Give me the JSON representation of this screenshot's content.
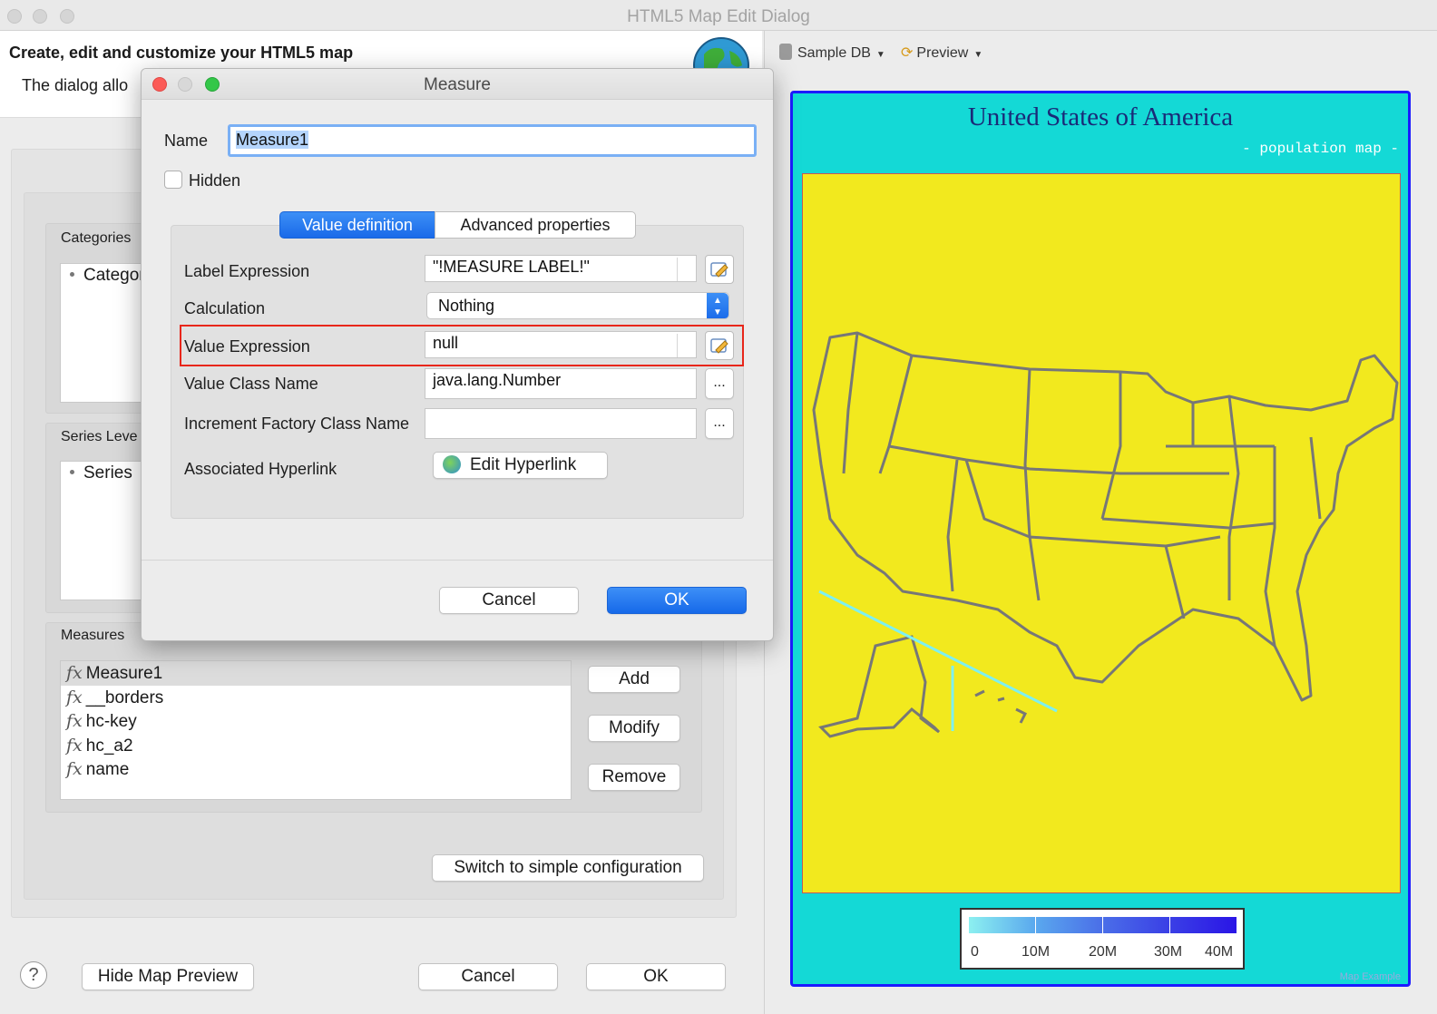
{
  "window": {
    "title": "HTML5 Map Edit Dialog"
  },
  "header": {
    "title": "Create, edit and customize your HTML5 map",
    "description": "The dialog allo"
  },
  "groups": {
    "categories_label": "Categories",
    "categories_item": "Categor",
    "series_label": "Series Leve",
    "series_item": "Series",
    "measures_label": "Measures"
  },
  "measures": {
    "items": [
      {
        "fx": "fx",
        "name": "Measure1"
      },
      {
        "fx": "fx",
        "name": "__borders"
      },
      {
        "fx": "fx",
        "name": "hc-key"
      },
      {
        "fx": "fx",
        "name": "hc_a2"
      },
      {
        "fx": "fx",
        "name": "name"
      }
    ],
    "add_label": "Add",
    "modify_label": "Modify",
    "remove_label": "Remove"
  },
  "footer": {
    "switch_label": "Switch to simple configuration",
    "help_label": "?",
    "hide_preview_label": "Hide Map Preview",
    "cancel_label": "Cancel",
    "ok_label": "OK"
  },
  "preview": {
    "datasource_label": "Sample DB",
    "preview_label": "Preview",
    "map_title": "United States of America",
    "map_subtitle": "- population map -",
    "legend_ticks": [
      "0",
      "10M",
      "20M",
      "30M",
      "40M"
    ],
    "legend_colors": [
      "#8cf0f0",
      "#5aa8ee",
      "#4a6ee8",
      "#3a3fe6",
      "#2a15e6"
    ],
    "credit": "Map Example"
  },
  "dialog": {
    "title": "Measure",
    "name_label": "Name",
    "name_value": "Measure1",
    "hidden_label": "Hidden",
    "tabs": [
      "Value definition",
      "Advanced properties"
    ],
    "label_expression_label": "Label Expression",
    "label_expression_value": "\"!MEASURE LABEL!\"",
    "calculation_label": "Calculation",
    "calculation_value": "Nothing",
    "value_expression_label": "Value Expression",
    "value_expression_value": "null",
    "value_class_label": "Value Class Name",
    "value_class_value": "java.lang.Number",
    "increment_label": "Increment Factory Class Name",
    "increment_value": "",
    "hyperlink_label": "Associated Hyperlink",
    "edit_hyperlink_label": "Edit Hyperlink",
    "ellipsis": "...",
    "cancel_label": "Cancel",
    "ok_label": "OK"
  }
}
